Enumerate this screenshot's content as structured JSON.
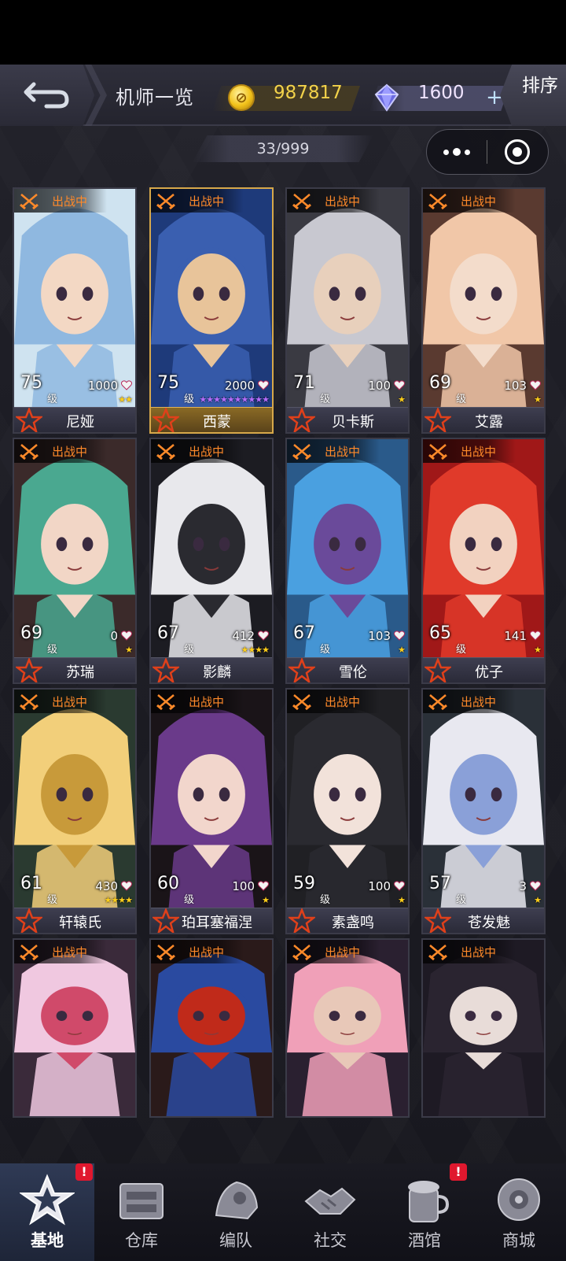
{
  "header": {
    "title": "机师一览",
    "gold": "987817",
    "gems": "1600",
    "plus": "+",
    "sort_label": "排序"
  },
  "roster_count": "33/999",
  "deploy_label": "出战中",
  "level_unit": "级",
  "cards": [
    {
      "name": "尼娅",
      "level": "75",
      "hp": "1000",
      "stars": "★★",
      "star_color": "#ffcf1a",
      "highlight": false,
      "palette": [
        "#cfe3f0",
        "#8fb8e0",
        "#f3d8c4"
      ]
    },
    {
      "name": "西蒙",
      "level": "75",
      "hp": "2000",
      "stars": "★★★★★★★★★★",
      "star_color": "#b56dff",
      "highlight": true,
      "palette": [
        "#1e3a7a",
        "#3a5fb0",
        "#e8c49a"
      ]
    },
    {
      "name": "贝卡斯",
      "level": "71",
      "hp": "100",
      "stars": "★",
      "star_color": "#ffcf1a",
      "highlight": false,
      "palette": [
        "#3a3a42",
        "#c8c8d0",
        "#e8d0bc"
      ]
    },
    {
      "name": "艾露",
      "level": "69",
      "hp": "103",
      "stars": "★",
      "star_color": "#ffcf1a",
      "highlight": false,
      "palette": [
        "#5a3a30",
        "#f1c7a8",
        "#f3dccb"
      ]
    },
    {
      "name": "苏瑞",
      "level": "69",
      "hp": "0",
      "stars": "★",
      "star_color": "#ffcf1a",
      "highlight": false,
      "palette": [
        "#3b2a2a",
        "#4aa890",
        "#f2d6c6"
      ]
    },
    {
      "name": "影麟",
      "level": "67",
      "hp": "412",
      "stars": "★★★★",
      "star_color": "#ffcf1a",
      "highlight": false,
      "palette": [
        "#1c1c22",
        "#e8e8ec",
        "#2a2a30"
      ]
    },
    {
      "name": "雪伦",
      "level": "67",
      "hp": "103",
      "stars": "★",
      "star_color": "#ffcf1a",
      "highlight": false,
      "palette": [
        "#2a5a8a",
        "#4aa0e0",
        "#6a4a9a"
      ]
    },
    {
      "name": "优子",
      "level": "65",
      "hp": "141",
      "stars": "★",
      "star_color": "#ffcf1a",
      "highlight": false,
      "palette": [
        "#a01818",
        "#e03a2a",
        "#f2d2c0"
      ]
    },
    {
      "name": "轩辕氏",
      "level": "61",
      "hp": "430",
      "stars": "★★★★",
      "star_color": "#ffcf1a",
      "highlight": false,
      "palette": [
        "#2a3a30",
        "#f2cf7a",
        "#c89a3a"
      ]
    },
    {
      "name": "珀耳塞福涅",
      "level": "60",
      "hp": "100",
      "stars": "★",
      "star_color": "#ffcf1a",
      "highlight": false,
      "palette": [
        "#1a1418",
        "#6a3a8a",
        "#f2d6cc"
      ]
    },
    {
      "name": "素盏鸣",
      "level": "59",
      "hp": "100",
      "stars": "★",
      "star_color": "#ffcf1a",
      "highlight": false,
      "palette": [
        "#202024",
        "#2a2a30",
        "#f2e2da"
      ]
    },
    {
      "name": "苍发魅",
      "level": "57",
      "hp": "3",
      "stars": "★",
      "star_color": "#ffcf1a",
      "highlight": false,
      "palette": [
        "#2a3038",
        "#e8e8f0",
        "#8aa0d8"
      ]
    },
    {
      "name": "",
      "level": "",
      "hp": "",
      "stars": "",
      "star_color": "#ffcf1a",
      "highlight": false,
      "palette": [
        "#3a2a3a",
        "#f0c8e0",
        "#d04a6a"
      ]
    },
    {
      "name": "",
      "level": "",
      "hp": "",
      "stars": "",
      "star_color": "#ffcf1a",
      "highlight": false,
      "palette": [
        "#2a1a1a",
        "#2a4aa0",
        "#c02a1a"
      ]
    },
    {
      "name": "",
      "level": "",
      "hp": "",
      "stars": "",
      "star_color": "#ffcf1a",
      "highlight": false,
      "palette": [
        "#2a2030",
        "#f0a0b8",
        "#e8c8b8"
      ]
    },
    {
      "name": "",
      "level": "",
      "hp": "",
      "stars": "",
      "star_color": "#ffcf1a",
      "highlight": false,
      "palette": [
        "#1e1a24",
        "#2a2430",
        "#e8dcd8"
      ]
    }
  ],
  "nav": [
    {
      "label": "基地",
      "icon": "base-icon",
      "active": true,
      "badge": "!"
    },
    {
      "label": "仓库",
      "icon": "warehouse-icon",
      "active": false,
      "badge": ""
    },
    {
      "label": "编队",
      "icon": "formation-icon",
      "active": false,
      "badge": ""
    },
    {
      "label": "社交",
      "icon": "social-icon",
      "active": false,
      "badge": ""
    },
    {
      "label": "酒馆",
      "icon": "tavern-icon",
      "active": false,
      "badge": "!"
    },
    {
      "label": "商城",
      "icon": "shop-icon",
      "active": false,
      "badge": ""
    }
  ],
  "colors": {
    "deploy_text": "#ff8a2a",
    "gold_text": "#f2d24a",
    "gem_text": "#f0e4ff",
    "highlight_border": "#d7a84a",
    "badge_red": "#e0182e"
  }
}
